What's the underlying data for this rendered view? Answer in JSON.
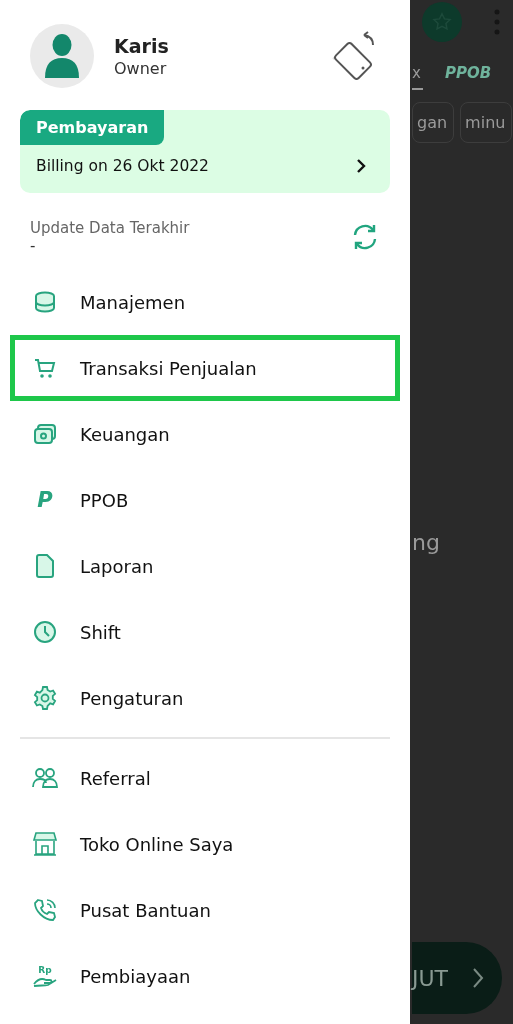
{
  "background_screen": {
    "tabs": [
      {
        "label": "x",
        "selected": true
      },
      {
        "label": "PPOB",
        "selected": false
      }
    ],
    "chips": [
      "gan",
      "minu"
    ],
    "text": "ng",
    "button": {
      "label": "JUT"
    }
  },
  "drawer": {
    "profile": {
      "name": "Karis",
      "role": "Owner"
    },
    "billing": {
      "tag": "Pembayaran",
      "text": "Billing on 26 Okt 2022"
    },
    "sync": {
      "label": "Update Data Terakhir",
      "value": "-"
    },
    "main_menu": [
      {
        "label": "Manajemen",
        "kind": "database",
        "highlighted": false
      },
      {
        "label": "Transaksi Penjualan",
        "kind": "cart",
        "highlighted": true
      },
      {
        "label": "Keuangan",
        "kind": "money",
        "highlighted": false
      },
      {
        "label": "PPOB",
        "kind": "letter",
        "icon_text": "P",
        "highlighted": false
      },
      {
        "label": "Laporan",
        "kind": "document",
        "highlighted": false
      },
      {
        "label": "Shift",
        "kind": "clock",
        "highlighted": false
      },
      {
        "label": "Pengaturan",
        "kind": "gear",
        "highlighted": false
      }
    ],
    "secondary_menu": [
      {
        "label": "Referral",
        "kind": "people",
        "highlighted": false
      },
      {
        "label": "Toko Online Saya",
        "kind": "store",
        "highlighted": false
      },
      {
        "label": "Pusat Bantuan",
        "kind": "phone",
        "highlighted": false
      },
      {
        "label": "Pembiayaan",
        "kind": "hand",
        "icon_text": "Rp",
        "highlighted": false
      }
    ]
  }
}
